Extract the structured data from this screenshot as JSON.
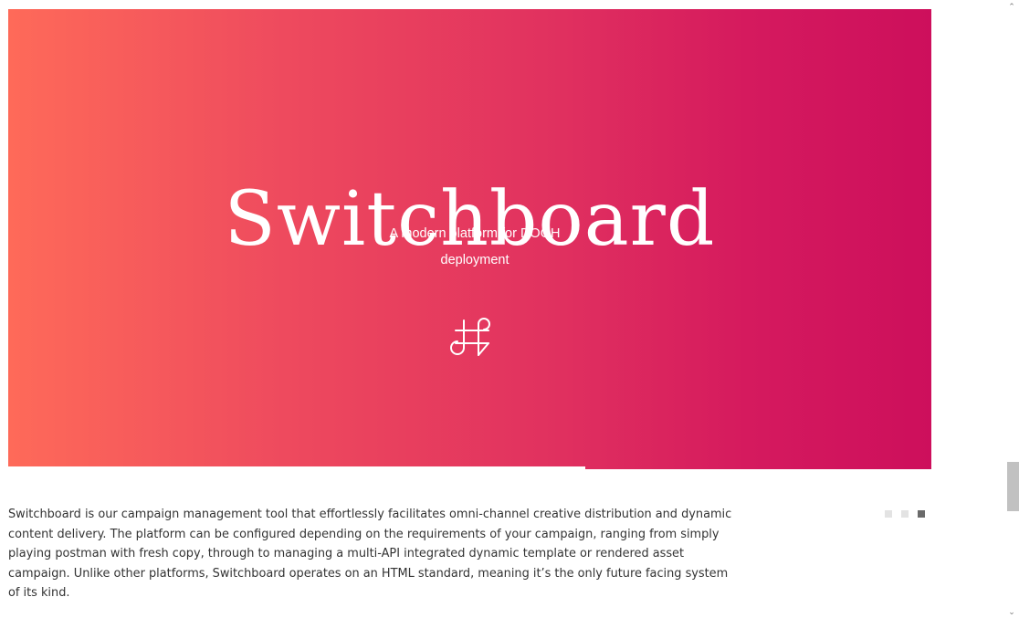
{
  "hero": {
    "title": "Switchboard",
    "subtitle": "A modern platform for DOOH deployment",
    "logo_icon": "command-key-icon",
    "gradient": [
      "#fe6a59",
      "#cd0f5c"
    ]
  },
  "intro": {
    "text": "Switchboard is our campaign management tool that effortlessly facilitates omni-channel creative distribution and dynamic content delivery. The platform can be configured depending on the requirements of your campaign, ranging from simply playing postman with fresh copy, through to managing a multi-API integrated dynamic template or rendered asset campaign. Unlike other platforms, Switchboard operates on an HTML standard, meaning it’s the only future facing system of its kind."
  },
  "pager": {
    "count": 3,
    "active_index": 2,
    "active_color": "#6a6a6a",
    "inactive_color": "#e3e3e3"
  },
  "scrollbar": {
    "up_icon": "chevron-up-icon",
    "down_icon": "chevron-down-icon",
    "up_glyph": "⌃",
    "down_glyph": "⌄"
  }
}
